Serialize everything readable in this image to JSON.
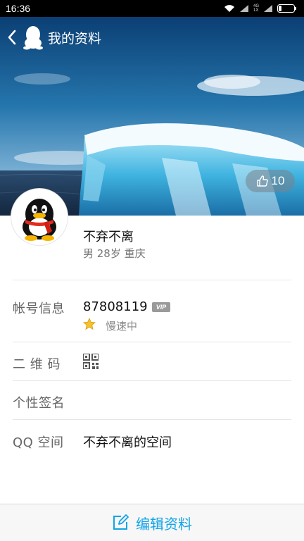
{
  "status_bar": {
    "time": "16:36",
    "network": [
      "4G",
      "1X"
    ]
  },
  "header": {
    "title": "我的资料"
  },
  "profile": {
    "likes": "10",
    "nickname": "不弃不离",
    "subinfo": "男 28岁 重庆"
  },
  "rows": {
    "account": {
      "label": "帐号信息",
      "value": "87808119",
      "badge": "VIP",
      "speed": "慢速中"
    },
    "qrcode": {
      "label": "二 维 码"
    },
    "signature": {
      "label": "个性签名",
      "value": ""
    },
    "qzone": {
      "label": "QQ 空间",
      "value": "不弃不离的空间"
    }
  },
  "bottom": {
    "edit_label": "编辑资料"
  },
  "colors": {
    "accent": "#12a4e8",
    "sky_top": "#0d4f86",
    "ocean": "#1f3f62",
    "ice": "#7fd3f0"
  }
}
